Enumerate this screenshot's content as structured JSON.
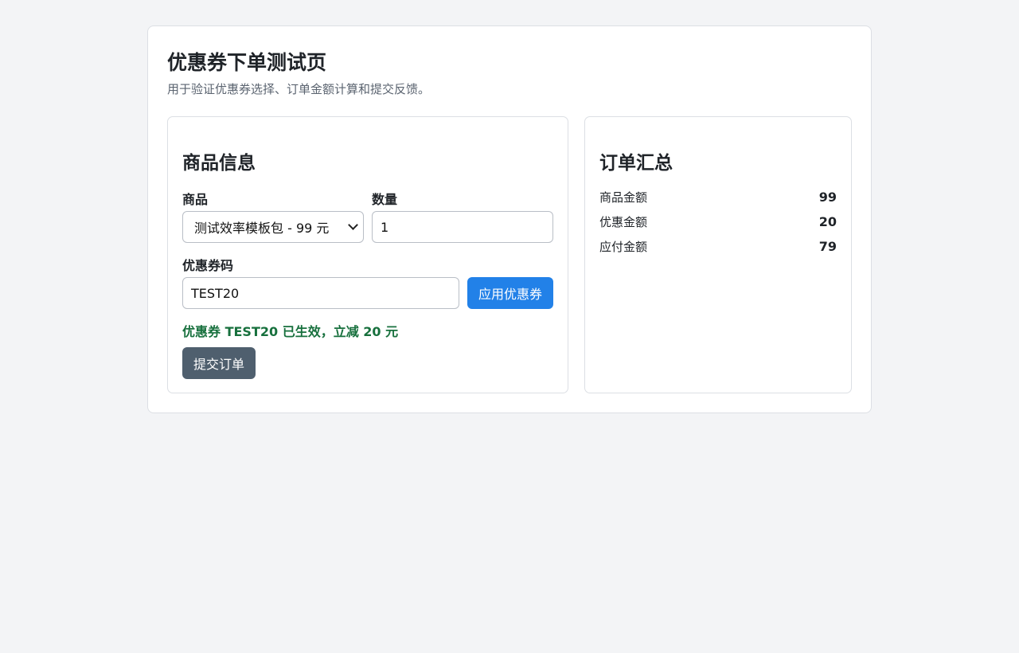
{
  "header": {
    "title": "优惠券下单测试页",
    "subtitle": "用于验证优惠券选择、订单金额计算和提交反馈。"
  },
  "product_panel": {
    "title": "商品信息",
    "product_label": "商品",
    "product_selected": "测试效率模板包 - 99 元",
    "quantity_label": "数量",
    "quantity_value": "1",
    "coupon_label": "优惠券码",
    "coupon_value": "TEST20",
    "apply_button": "应用优惠券",
    "status_message": "优惠券 TEST20 已生效，立减 20 元",
    "submit_button": "提交订单"
  },
  "summary_panel": {
    "title": "订单汇总",
    "rows": [
      {
        "label": "商品金额",
        "value": "99"
      },
      {
        "label": "优惠金额",
        "value": "20"
      },
      {
        "label": "应付金额",
        "value": "79"
      }
    ]
  },
  "colors": {
    "background": "#f3f4f6",
    "primary_button": "#2281e8",
    "secondary_button": "#4f5f6e",
    "success_text": "#17703d"
  },
  "icons": {
    "select_arrow": "chevron-down-icon"
  }
}
